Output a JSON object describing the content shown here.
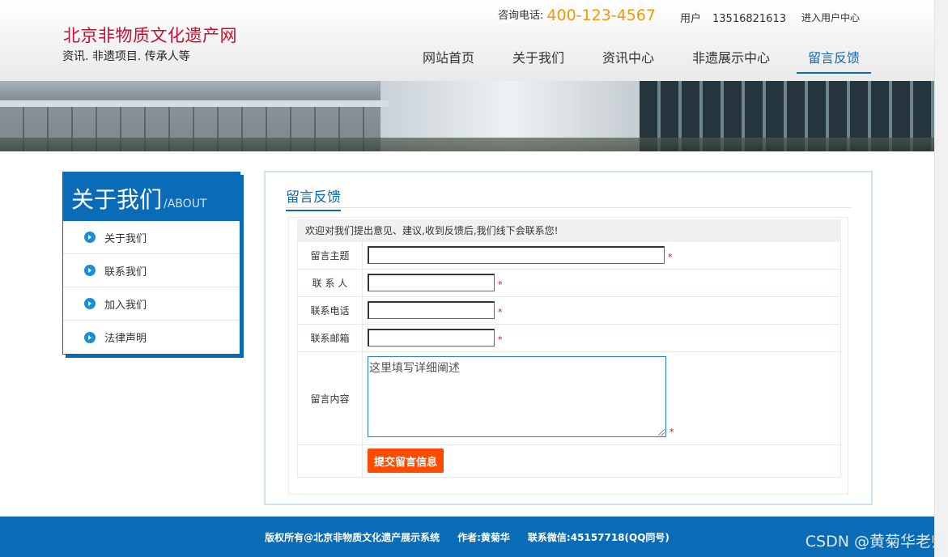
{
  "header": {
    "site_title": "北京非物质文化遗产网",
    "site_subtitle": "资讯. 非遗项目. 传承人等",
    "hotline_label": "咨询电话:",
    "hotline_number": "400-123-4567",
    "user_label": "用户",
    "user_phone": "13516821613",
    "user_center_link": "进入用户中心"
  },
  "nav": {
    "items": [
      {
        "label": "网站首页"
      },
      {
        "label": "关于我们"
      },
      {
        "label": "资讯中心"
      },
      {
        "label": "非遗展示中心"
      },
      {
        "label": "留言反馈"
      }
    ],
    "active": "留言反馈"
  },
  "sidebar": {
    "title": "关于我们",
    "title_en": "/ABOUT",
    "items": [
      {
        "label": "关于我们"
      },
      {
        "label": "联系我们"
      },
      {
        "label": "加入我们"
      },
      {
        "label": "法律声明"
      }
    ]
  },
  "main": {
    "title": "留言反馈",
    "intro": "欢迎对我们提出意见、建议,收到反馈后,我们线下会联系您!",
    "fields": {
      "subject_label": "留言主题",
      "contact_label": "联 系 人",
      "phone_label": "联系电话",
      "email_label": "联系邮箱",
      "content_label": "留言内容",
      "content_placeholder": "这里填写详细阐述",
      "required_mark": "*"
    },
    "submit_label": "提交留言信息"
  },
  "footer": {
    "copyright": "版权所有@北京非物质文化遗产展示系统",
    "author": "作者:黄菊华",
    "contact": "联系微信:45157718(QQ同号)"
  },
  "watermark": "CSDN @黄菊华老师",
  "colors": {
    "brand_blue": "#0a6bb7",
    "title_red": "#c8102e",
    "hotline_orange": "#f39800",
    "submit_orange": "#ff4b00"
  }
}
